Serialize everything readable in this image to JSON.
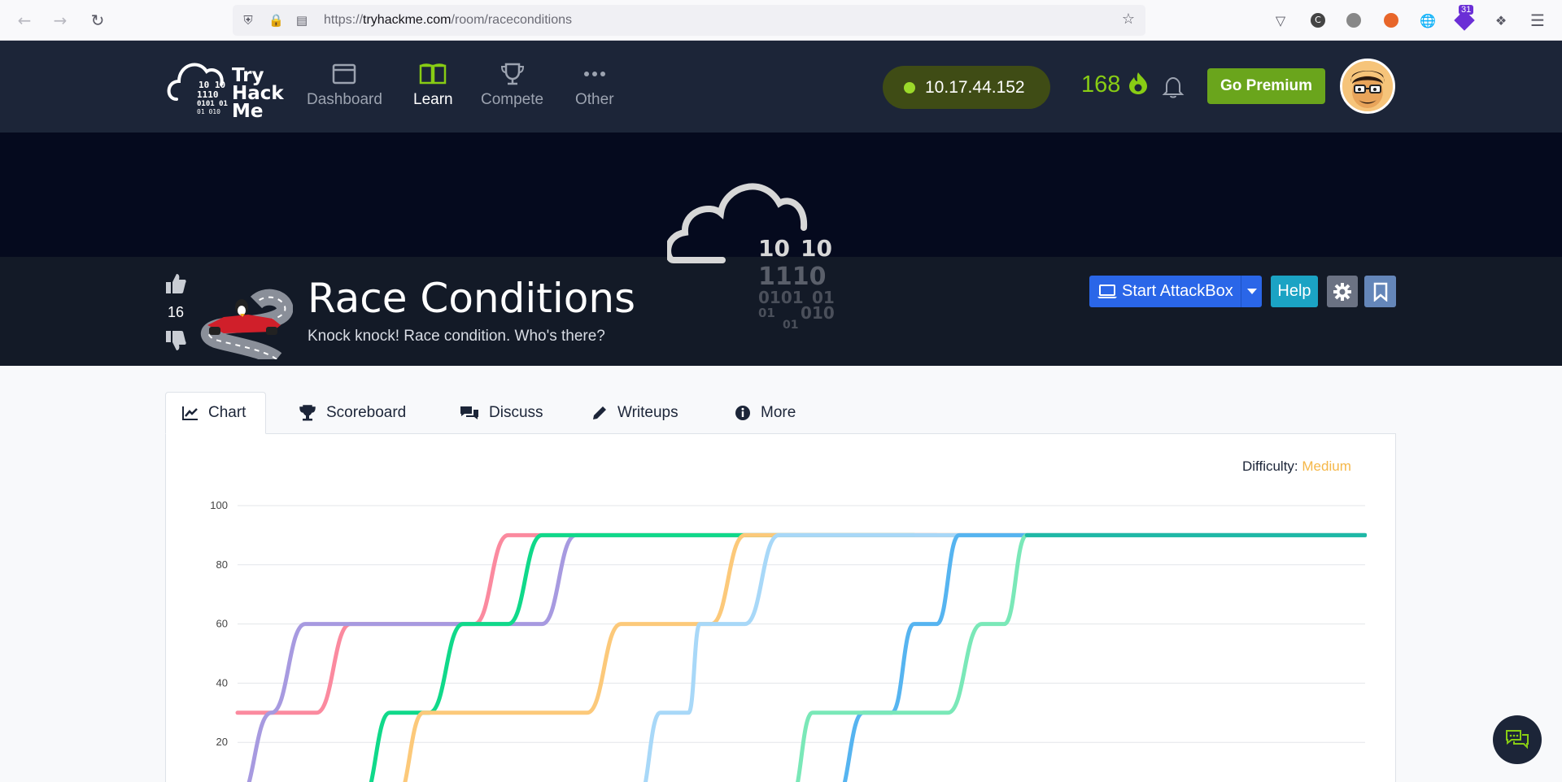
{
  "browser": {
    "url_prefix": "https://",
    "url_host": "tryhackme.com",
    "url_path": "/room/raceconditions",
    "extension_badge": "31"
  },
  "header": {
    "logo_text_1": "Try",
    "logo_text_2": "Hack",
    "logo_text_3": "Me",
    "nav": [
      {
        "label": "Dashboard",
        "icon": "dashboard-icon"
      },
      {
        "label": "Learn",
        "icon": "book-icon"
      },
      {
        "label": "Compete",
        "icon": "trophy-icon"
      },
      {
        "label": "Other",
        "icon": "dots-icon"
      }
    ],
    "ip_address": "10.17.44.152",
    "streak": "168",
    "premium_label": "Go Premium"
  },
  "room": {
    "votes": "16",
    "title": "Race Conditions",
    "subtitle": "Knock knock! Race condition. Who's there?",
    "attack_label": "Start AttackBox",
    "help_label": "Help",
    "cloud_binary": [
      "10",
      "10",
      "1110",
      "0101",
      "01",
      "01",
      "010",
      "01"
    ]
  },
  "tabs": [
    {
      "label": "Chart",
      "icon": "line-chart-icon"
    },
    {
      "label": "Scoreboard",
      "icon": "trophy-icon"
    },
    {
      "label": "Discuss",
      "icon": "comments-icon"
    },
    {
      "label": "Writeups",
      "icon": "pencil-icon"
    },
    {
      "label": "More",
      "icon": "info-icon"
    }
  ],
  "difficulty": {
    "label": "Difficulty:",
    "value": "Medium"
  },
  "colors": {
    "header_bg": "#1c2538",
    "accent_green": "#88cc14",
    "premium_green": "#6aa51c",
    "attack_blue": "#2a66e8",
    "help_teal": "#1ba3c4",
    "difficulty_orange": "#f5b748"
  },
  "chart_data": {
    "type": "line",
    "yticks": [
      20,
      40,
      60,
      80,
      100
    ],
    "ylim": [
      0,
      100
    ],
    "x_range": [
      0,
      1
    ],
    "series": [
      {
        "color": "#fb8a9f",
        "points": [
          [
            0.0,
            30
          ],
          [
            0.07,
            30
          ],
          [
            0.1,
            60
          ],
          [
            0.21,
            60
          ],
          [
            0.24,
            90
          ],
          [
            1.0,
            90
          ]
        ]
      },
      {
        "color": "#a79ae0",
        "points": [
          [
            0.0,
            0
          ],
          [
            0.03,
            30
          ],
          [
            0.06,
            60
          ],
          [
            0.27,
            60
          ],
          [
            0.3,
            90
          ],
          [
            0.62,
            90
          ]
        ]
      },
      {
        "color": "#10d98a",
        "points": [
          [
            0.11,
            0
          ],
          [
            0.135,
            30
          ],
          [
            0.17,
            30
          ],
          [
            0.2,
            60
          ],
          [
            0.24,
            60
          ],
          [
            0.27,
            90
          ],
          [
            0.6,
            90
          ]
        ]
      },
      {
        "color": "#fcc97a",
        "points": [
          [
            0.14,
            0
          ],
          [
            0.165,
            30
          ],
          [
            0.31,
            30
          ],
          [
            0.34,
            60
          ],
          [
            0.42,
            60
          ],
          [
            0.45,
            90
          ],
          [
            0.7,
            90
          ]
        ]
      },
      {
        "color": "#a8d8f8",
        "points": [
          [
            0.355,
            0
          ],
          [
            0.375,
            30
          ],
          [
            0.4,
            30
          ],
          [
            0.41,
            60
          ],
          [
            0.45,
            60
          ],
          [
            0.48,
            90
          ],
          [
            0.9,
            90
          ]
        ]
      },
      {
        "color": "#56b4f0",
        "points": [
          [
            0.53,
            0
          ],
          [
            0.555,
            30
          ],
          [
            0.58,
            30
          ],
          [
            0.6,
            60
          ],
          [
            0.62,
            60
          ],
          [
            0.64,
            90
          ],
          [
            1.0,
            90
          ]
        ]
      },
      {
        "color": "#7ae8b8",
        "points": [
          [
            0.49,
            0
          ],
          [
            0.51,
            30
          ],
          [
            0.63,
            30
          ],
          [
            0.66,
            60
          ],
          [
            0.68,
            60
          ],
          [
            0.7,
            90
          ],
          [
            1.0,
            90
          ]
        ]
      },
      {
        "color": "#1fb8a6",
        "points": [
          [
            0.7,
            90
          ],
          [
            1.0,
            90
          ]
        ]
      }
    ]
  }
}
